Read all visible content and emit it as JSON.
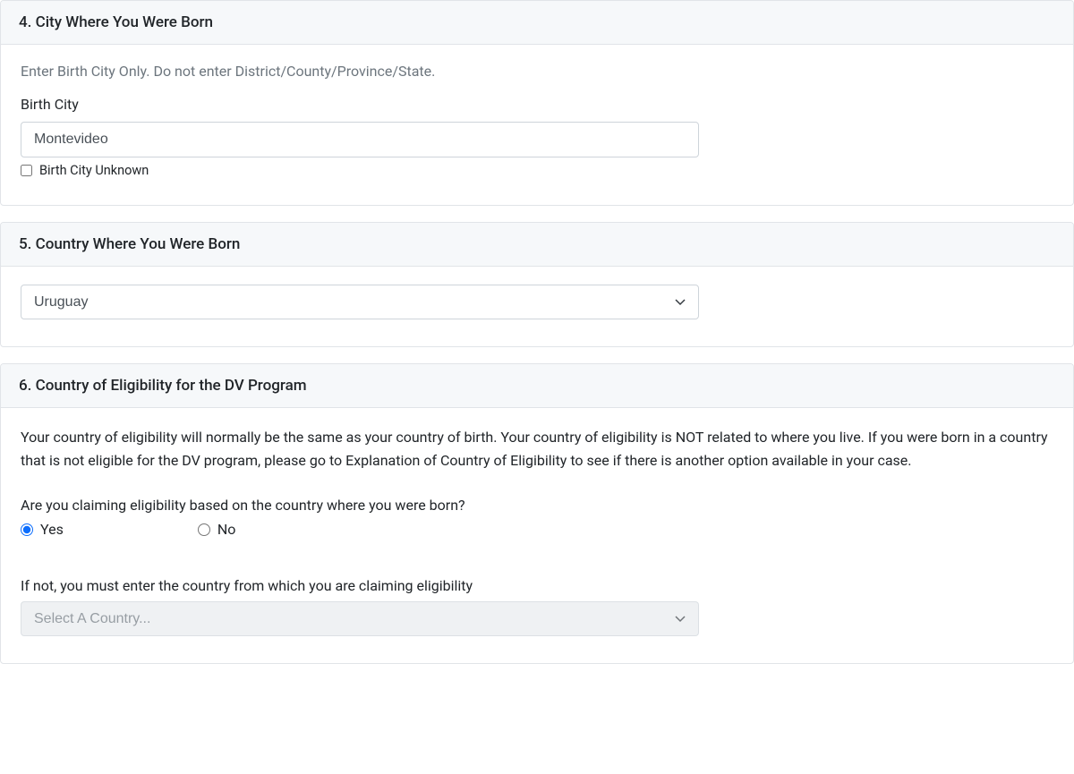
{
  "section4": {
    "header": "4. City Where You Were Born",
    "help": "Enter Birth City Only. Do not enter District/County/Province/State.",
    "label": "Birth City",
    "value": "Montevideo",
    "checkbox_label": "Birth City Unknown"
  },
  "section5": {
    "header": "5. Country Where You Were Born",
    "selected": "Uruguay"
  },
  "section6": {
    "header": "6. Country of Eligibility for the DV Program",
    "info": "Your country of eligibility will normally be the same as your country of birth. Your country of eligibility is NOT related to where you live. If you were born in a country that is not eligible for the DV program, please go to Explanation of Country of Eligibility to see if there is another option available in your case.",
    "question": "Are you claiming eligibility based on the country where you were born?",
    "option_yes": "Yes",
    "option_no": "No",
    "eligiblity_label": "If not, you must enter the country from which you are claiming eligibility",
    "eligibility_placeholder": "Select A Country..."
  }
}
